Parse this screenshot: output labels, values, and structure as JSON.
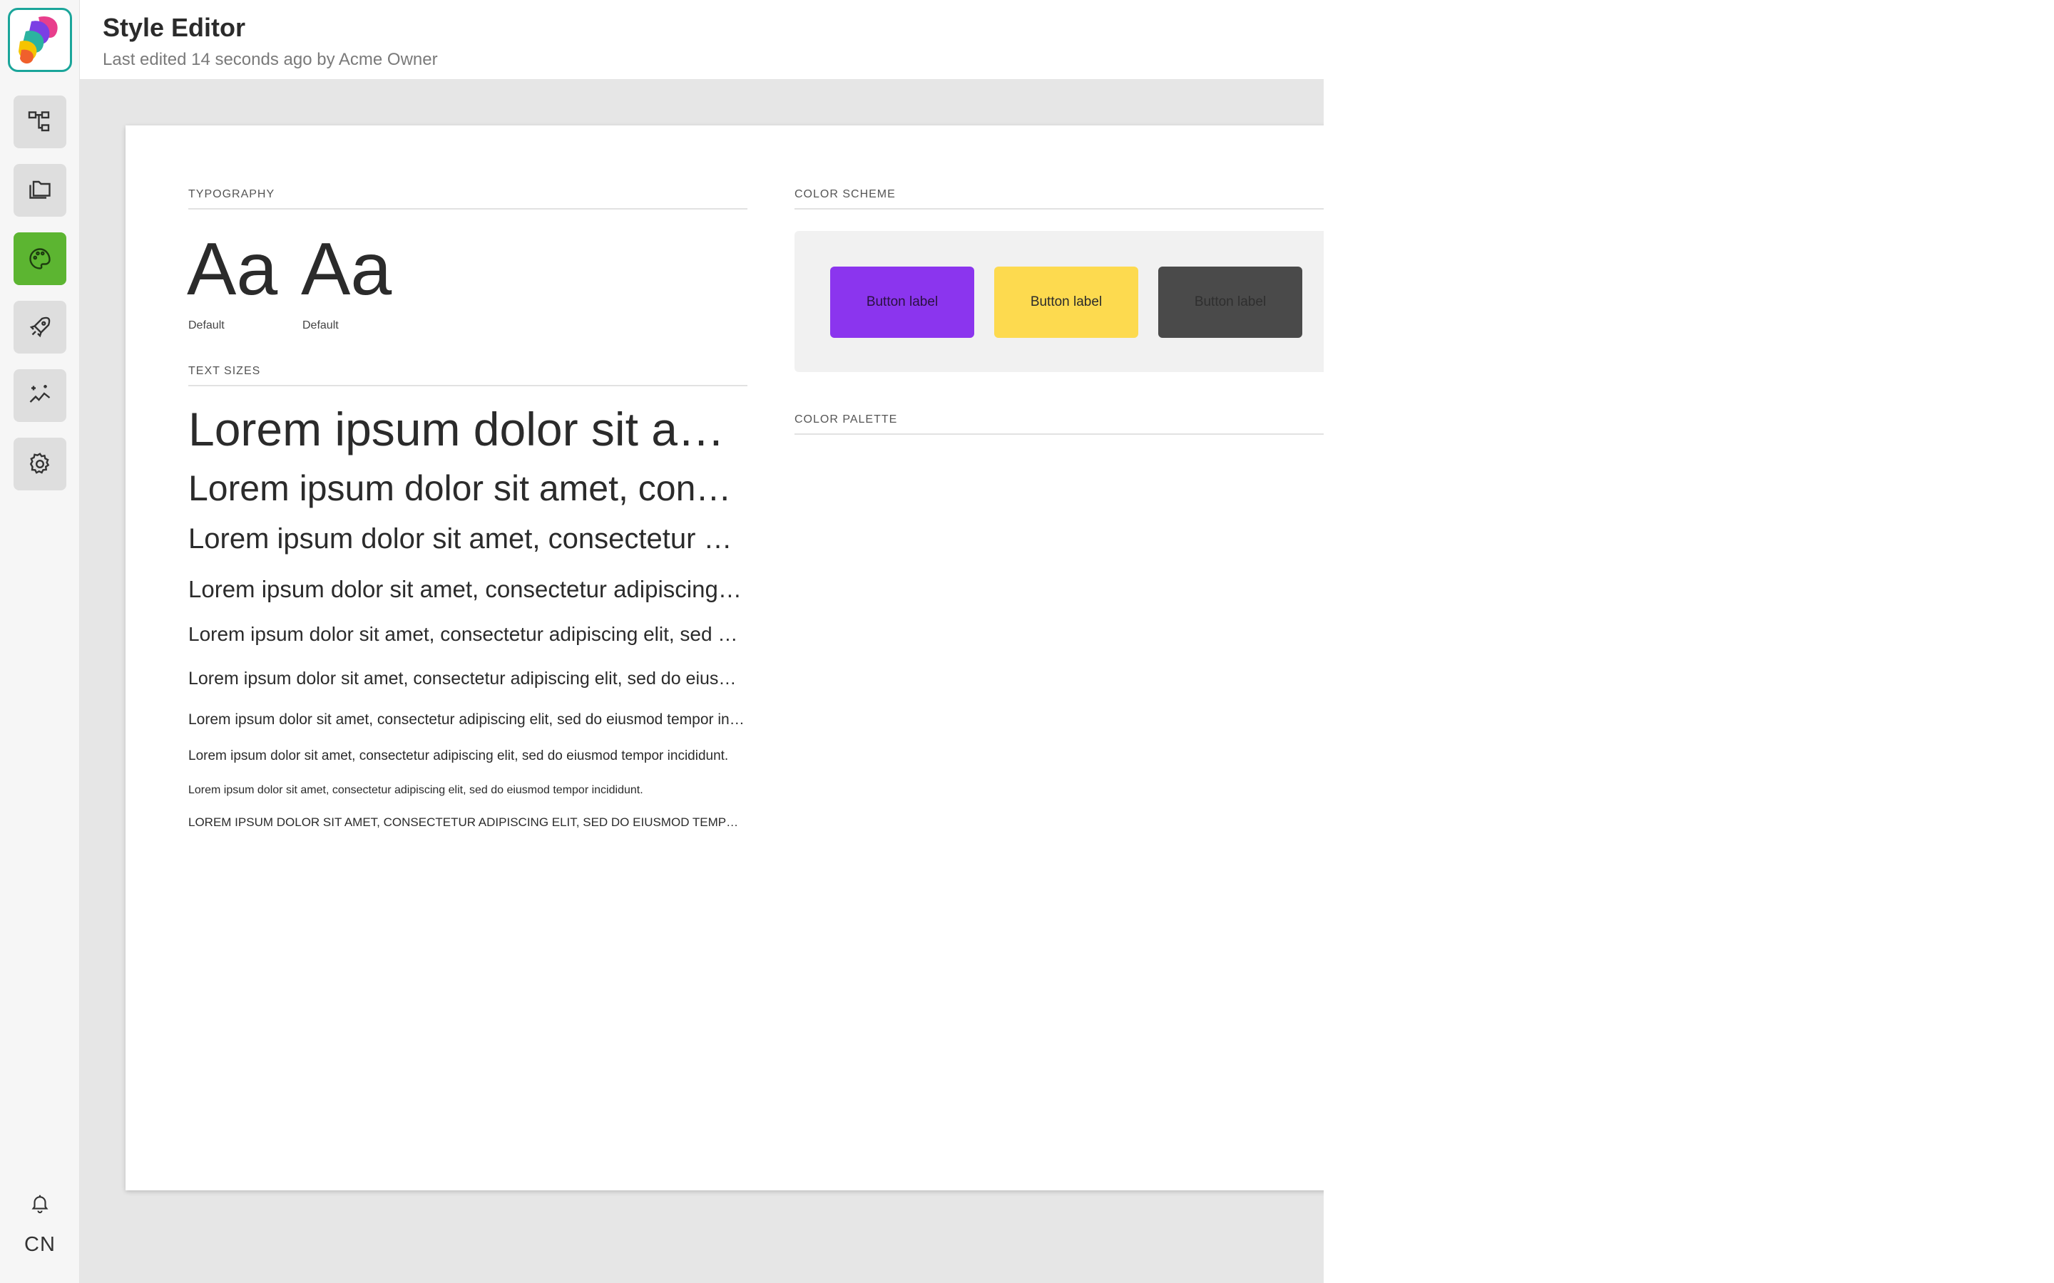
{
  "header": {
    "title": "Style Editor",
    "subtitle": "Last edited 14 seconds ago by Acme Owner"
  },
  "sidebar": {
    "items": [
      {
        "name": "sitemap",
        "icon": "sitemap-icon",
        "active": false
      },
      {
        "name": "files",
        "icon": "folders-icon",
        "active": false
      },
      {
        "name": "style",
        "icon": "palette-icon",
        "active": true
      },
      {
        "name": "launch",
        "icon": "rocket-icon",
        "active": false
      },
      {
        "name": "analytics",
        "icon": "sparkle-chart-icon",
        "active": false
      },
      {
        "name": "settings",
        "icon": "gear-icon",
        "active": false
      }
    ],
    "notifications_icon": "bell-icon",
    "user_initials": "CN",
    "accent_color": "#5cb531"
  },
  "typography": {
    "label": "TYPOGRAPHY",
    "samples": [
      {
        "glyph": "Aa",
        "caption": "Default"
      },
      {
        "glyph": "Aa",
        "caption": "Default"
      }
    ]
  },
  "text_sizes": {
    "label": "TEXT SIZES",
    "lines": [
      "Lorem ipsum dolor sit amet, consectetur adipiscing elit, sed do eiusmod tempor incididunt.",
      "Lorem ipsum dolor sit amet, consectetur adipiscing elit, sed do eiusmod tempor incididunt.",
      "Lorem ipsum dolor sit amet, consectetur adipiscing elit, sed do eiusmod tempor incididunt.",
      "Lorem ipsum dolor sit amet, consectetur adipiscing elit, sed do eiusmod tempor incididunt.",
      "Lorem ipsum dolor sit amet, consectetur adipiscing elit, sed do eiusmod tempor incididunt.",
      "Lorem ipsum dolor sit amet, consectetur adipiscing elit, sed do eiusmod tempor incididunt.",
      "Lorem ipsum dolor sit amet, consectetur adipiscing elit, sed do eiusmod tempor incididunt.",
      "Lorem ipsum dolor sit amet, consectetur adipiscing elit, sed do eiusmod tempor incididunt.",
      "Lorem ipsum dolor sit amet, consectetur adipiscing elit, sed do eiusmod tempor incididunt.",
      "LOREM IPSUM DOLOR SIT AMET, CONSECTETUR ADIPISCING ELIT, SED DO EIUSMOD TEMPOR INCIDIDUNT."
    ]
  },
  "color_scheme": {
    "label": "COLOR SCHEME",
    "buttons": [
      {
        "label": "Button label",
        "background": "#8b35ee",
        "text_color": "#2a1140"
      },
      {
        "label": "Button label",
        "background": "#fdda4f",
        "text_color": "#2b2b2b"
      },
      {
        "label": "Button label",
        "background": "#4a4a4a",
        "text_color": "#2f2f2f"
      }
    ]
  },
  "color_palette": {
    "label": "COLOR PALETTE"
  },
  "navigation": {
    "next_icon": "arrow-right-icon"
  }
}
